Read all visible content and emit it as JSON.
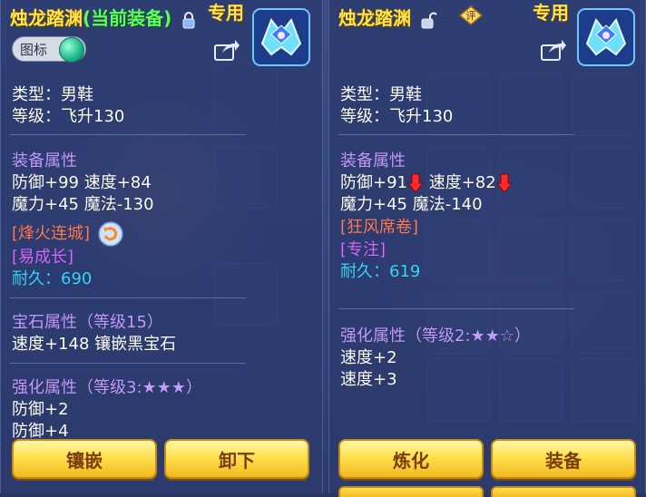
{
  "left": {
    "title": "烛龙踏渊",
    "equipped": "(当前装备)",
    "exclusive": "专用",
    "toggle_label": "图标",
    "type_label": "类型：男鞋",
    "level_label": "等级：飞升130",
    "attr_header": "装备属性",
    "attr_line1": "防御+99 速度+84",
    "attr_line2": "魔力+45 魔法-130",
    "skill1": "[烽火连城]",
    "skill2": "[易成长]",
    "durability": "耐久：690",
    "gem_header": "宝石属性（等级15）",
    "gem_line": "速度+148 镶嵌黑宝石",
    "enhance_header": "强化属性（等级3:★★★）",
    "enhance_line1": "防御+2",
    "enhance_line2": "防御+4",
    "btn_inlay": "镶嵌",
    "btn_unequip": "卸下"
  },
  "right": {
    "title": "烛龙踏渊",
    "exclusive": "专用",
    "rate_label": "评",
    "type_label": "类型：男鞋",
    "level_label": "等级：飞升130",
    "attr_header": "装备属性",
    "attr_line1a": "防御+91",
    "attr_line1b": " 速度+82",
    "attr_line2": "魔力+45 魔法-140",
    "skill1": "[狂风席卷]",
    "skill2": "[专注]",
    "durability": "耐久：619",
    "enhance_header": "强化属性（等级2:★★☆）",
    "enhance_line1": "速度+2",
    "enhance_line2": "速度+3",
    "btn_refine": "炼化",
    "btn_equip": "装备"
  },
  "colors": {
    "title": "#ffe54a",
    "equipped": "#59ff62",
    "section": "#c49bff",
    "skill_orange": "#ff7b56",
    "skill_purple": "#d56bff",
    "durability": "#38d7ff",
    "button": "#ffe14f"
  }
}
